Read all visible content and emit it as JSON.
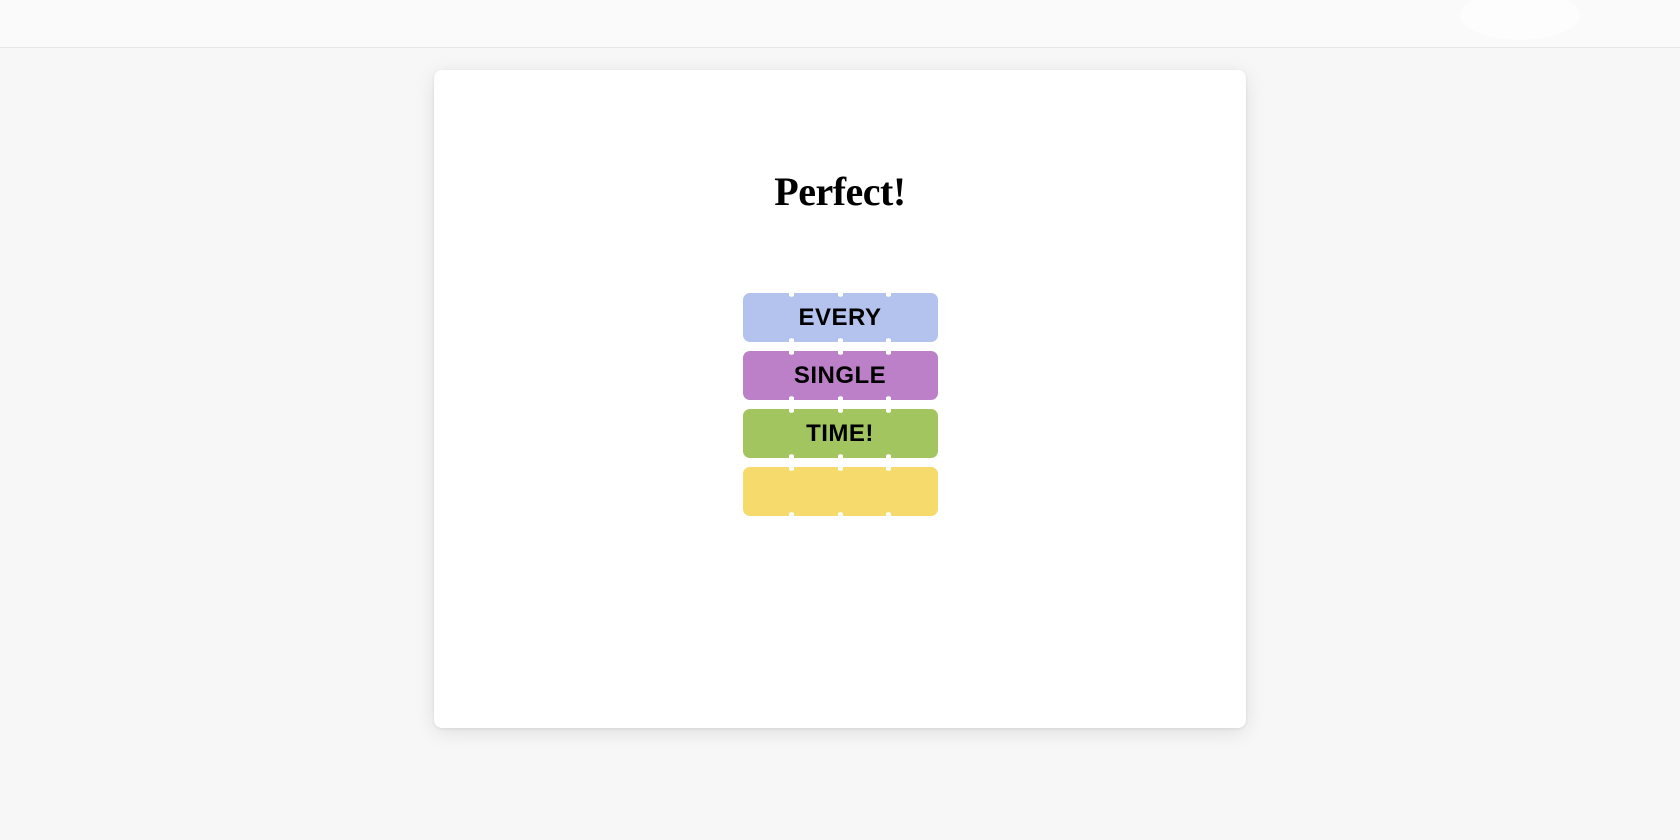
{
  "modal": {
    "title": "Perfect!",
    "rows": [
      {
        "label": "EVERY",
        "color": "#b4c3ee"
      },
      {
        "label": "SINGLE",
        "color": "#bb80c8"
      },
      {
        "label": "TIME!",
        "color": "#a2c560"
      },
      {
        "label": "",
        "color": "#f7da6c"
      }
    ]
  }
}
